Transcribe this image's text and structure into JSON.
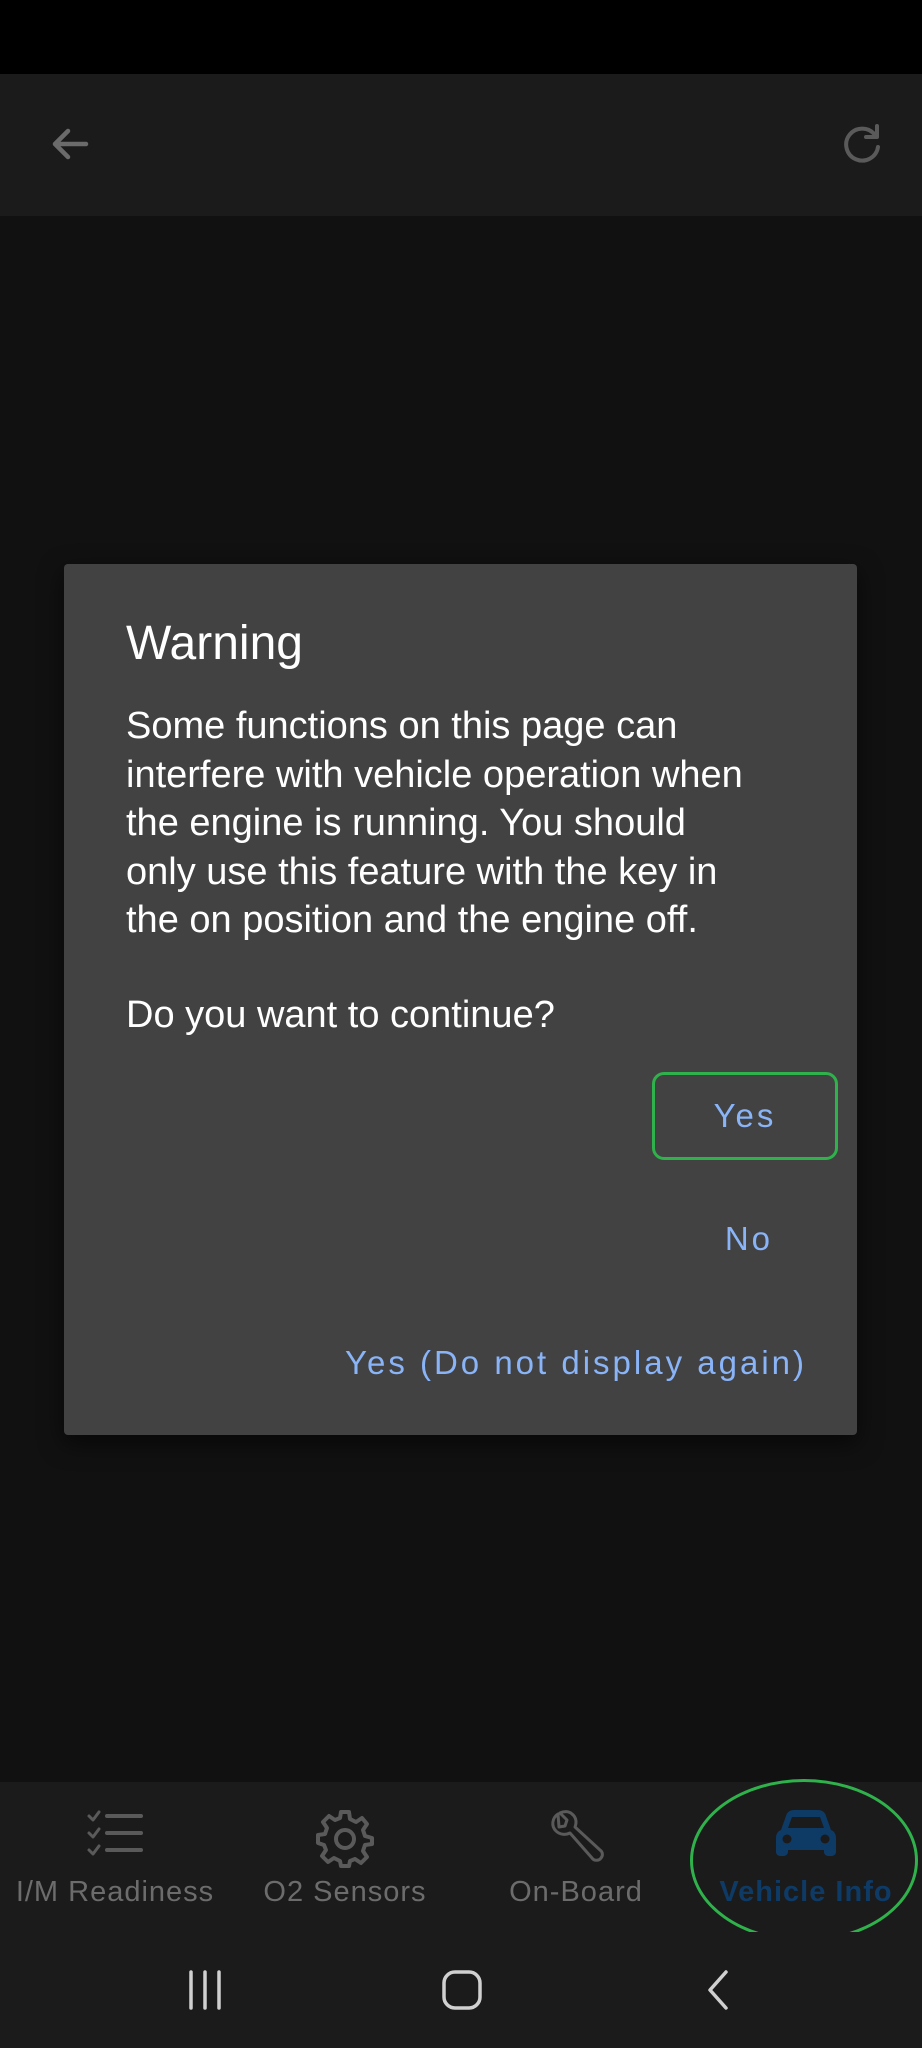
{
  "dialog": {
    "title": "Warning",
    "message": "Some functions on this page can\ninterfere with vehicle operation when\nthe engine is running. You should\nonly use this feature with the key in\nthe on position and the engine off.",
    "question": "Do you want to continue?",
    "yes_label": "Yes",
    "no_label": "No",
    "yes_never_label": "Yes (Do not display again)"
  },
  "bottom_nav": {
    "items": [
      {
        "label": "I/M Readiness",
        "icon": "checklist-icon"
      },
      {
        "label": "O2 Sensors",
        "icon": "gear-icon"
      },
      {
        "label": "On-Board",
        "icon": "wrench-icon"
      },
      {
        "label": "Vehicle Info",
        "icon": "car-icon",
        "active": true
      }
    ]
  },
  "colors": {
    "accent_button_text": "#8ab4f8",
    "highlight_ring": "#2fb14b",
    "active_nav": "#0e3a66",
    "dialog_bg": "#424242"
  }
}
